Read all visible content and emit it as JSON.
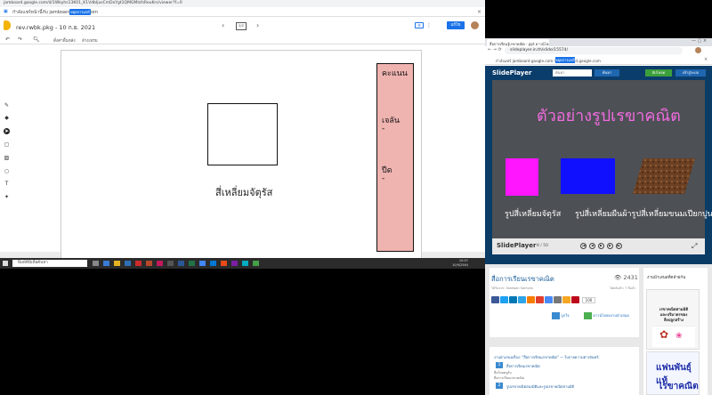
{
  "jamboard": {
    "url": "jamboard.google.com/d/1Wkyhs13K01_K1VdbIjusCmDxYgt1QMGMIsfsReuKrs/viewer?f=0",
    "share_message": "กำลังแชร์หน้านี้กับ jamboard.google.com",
    "stop_share": "หยุดการแชร์",
    "title": "rev.rwbk.pkg - 10 ก.ย. 2021",
    "frame_indicator": "2/2",
    "set_label": "⚙",
    "edit_label": "แก้ไข",
    "toolbar": {
      "set_bg": "ตั้งค่าพื้นหลัง",
      "clear_frame": "ล้างเฟรม"
    },
    "canvas": {
      "square_label": "สี่เหลี่ยมจัตุรัส",
      "score_title": "คะแนน",
      "score_item1": "เจลัน",
      "score_val1": "-",
      "score_item2": "ปีด",
      "score_val2": "-"
    }
  },
  "taskbar": {
    "search_placeholder": "พิมพ์ที่นี่เพื่อค้นหา",
    "time": "10:07",
    "date": "10/9/2564"
  },
  "slideplayer": {
    "tab_title": "สื่อการเรียนรู้เรขาคณิต - ppt ดาวน์โหลด",
    "url": "slideplayer.in.th/slide/15574/",
    "share_message": "กำลังแชร์ jamboard.google.com กับ jamboard.google.com",
    "stop_share": "หยุดการแชร์",
    "nav": {
      "logo": "SlidePlayer",
      "search_placeholder": "ค้นหา",
      "search_button": "ค้นหา",
      "upload_button": "อัปโหลด",
      "login_button": "เข้าสู่ระบบ"
    },
    "slide": {
      "title": "ตัวอย่างรูปเรขาคณิต",
      "label1": "รูปสี่เหลี่ยมจัตุรัส",
      "label2": "รูปสี่เหลี่ยมผืนผ้า",
      "label3": "รูปสี่เหลี่ยมขนมเปียกปูน"
    },
    "player": {
      "logo": "SlidePlayer",
      "page": "8 / 50"
    },
    "presentation": {
      "title": "สื่อการเรียนเรขาคณิต",
      "views": "2431",
      "uploaded_by": "ได้รับจาก: Vorawan Somyon",
      "category": "โพสต์แล้ว: 7 ปีแล้ว",
      "share_count": "100",
      "btn_like": "ถูกใจ",
      "btn_download": "ดาวน์โหลดงานนำเสนอ"
    },
    "related": {
      "title": "งานนำเสนอเรื่อง: \"สื่อการเรียนเรขาคณิต\" — ใบถ่ายความต่างจันทร์:",
      "items": [
        {
          "n": "1",
          "t": "สื่อการเรียนเรขาคณิต",
          "s1": "สื่อโดยครูลัน",
          "s2": "สื่อการเรียนเรขาคณิต"
        },
        {
          "n": "2",
          "t": "รูปเรขาคณิตสองมิติและรูปเรขาคณิตสามมิติ",
          "s1": "",
          "s2": ""
        }
      ]
    },
    "right_col": {
      "heading": "งานนำเสนอที่คล้ายกัน",
      "ad1_lines": [
        "เรขาคณิตสามมิติ",
        "และปริมาตรของ",
        "สิ่งปลูกสร้าง"
      ],
      "ad2_line1": "แฟนพันธุ์แท้",
      "ad2_line2": "เรขาคณิต"
    }
  },
  "colors": {
    "score_panel": "#efb3b0",
    "slide_title": "#f06be0",
    "shape_magenta": "#ff16ff",
    "shape_blue": "#1010ff",
    "google_blue": "#1a73e8",
    "slideplayer_nav": "#0b3d6b"
  }
}
